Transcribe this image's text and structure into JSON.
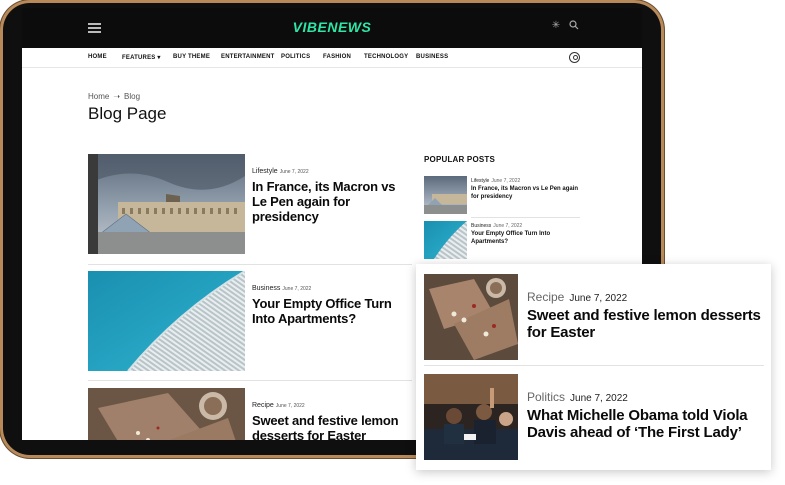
{
  "brand": {
    "name": "VIBENEWS",
    "accent": "#2ee6a6"
  },
  "nav": {
    "items": [
      "HOME",
      "FEATURES ▾",
      "BUY THEME",
      "ENTERTAINMENT",
      "POLITICS",
      "FASHION",
      "TECHNOLOGY",
      "BUSINESS"
    ]
  },
  "icons": {
    "menu": "hamburger-icon",
    "theme": "sun-icon",
    "search": "search-icon",
    "user": "user-icon",
    "breadcrumb_sep": "arrow-right-icon"
  },
  "breadcrumb": {
    "home": "Home",
    "sep": "➝",
    "current": "Blog"
  },
  "page": {
    "title": "Blog Page"
  },
  "posts": [
    {
      "category": "Lifestyle",
      "date": "June 7, 2022",
      "title": "In France, its Macron vs Le Pen again for presidency"
    },
    {
      "category": "Business",
      "date": "June 7, 2022",
      "title": "Your Empty Office Turn Into Apartments?"
    },
    {
      "category": "Recipe",
      "date": "June 7, 2022",
      "title": "Sweet and festive lemon desserts for Easter"
    }
  ],
  "popular": {
    "title": "POPULAR POSTS",
    "items": [
      {
        "category": "Lifestyle",
        "date": "June 7, 2022",
        "title": "In France, its Macron vs Le Pen again for presidency"
      },
      {
        "category": "Business",
        "date": "June 7, 2022",
        "title": "Your Empty Office Turn Into Apartments?"
      }
    ]
  },
  "card": {
    "items": [
      {
        "category": "Recipe",
        "date": "June 7, 2022",
        "title": "Sweet and festive lemon desserts for Easter"
      },
      {
        "category": "Politics",
        "date": "June 7, 2022",
        "title": "What Michelle Obama told Viola Davis ahead of ‘The First Lady’"
      }
    ]
  }
}
